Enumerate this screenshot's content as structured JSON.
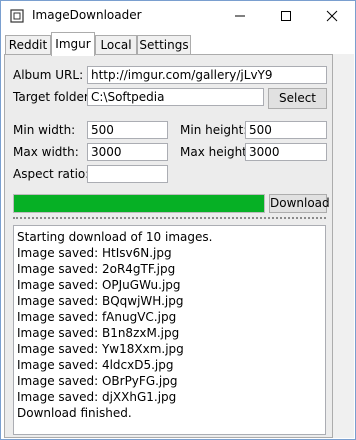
{
  "window": {
    "title": "ImageDownloader"
  },
  "tabs": [
    "Reddit",
    "Imgur",
    "Local",
    "Settings"
  ],
  "active_tab": "Imgur",
  "form": {
    "album_url_label": "Album URL:",
    "album_url_value": "http://imgur.com/gallery/jLvY9",
    "target_folder_label": "Target folder:",
    "target_folder_value": "C:\\Softpedia",
    "select_label": "Select",
    "min_width_label": "Min width:",
    "min_width_value": "500",
    "min_height_label": "Min height:",
    "min_height_value": "500",
    "max_width_label": "Max width:",
    "max_width_value": "3000",
    "max_height_label": "Max height:",
    "max_height_value": "3000",
    "aspect_ratio_label": "Aspect ratio:",
    "aspect_ratio_value": ""
  },
  "progress": {
    "fraction": 1.0,
    "color": "#06b025"
  },
  "download_label": "Download",
  "log_lines": [
    "Starting download of 10 images.",
    "Image saved: HtIsv6N.jpg",
    "Image saved: 2oR4gTF.jpg",
    "Image saved: OPJuGWu.jpg",
    "Image saved: BQqwjWH.jpg",
    "Image saved: fAnugVC.jpg",
    "Image saved: B1n8zxM.jpg",
    "Image saved: Yw18Xxm.jpg",
    "Image saved: 4ldcxD5.jpg",
    "Image saved: OBrPyFG.jpg",
    "Image saved: djXXhG1.jpg",
    "Download finished."
  ]
}
